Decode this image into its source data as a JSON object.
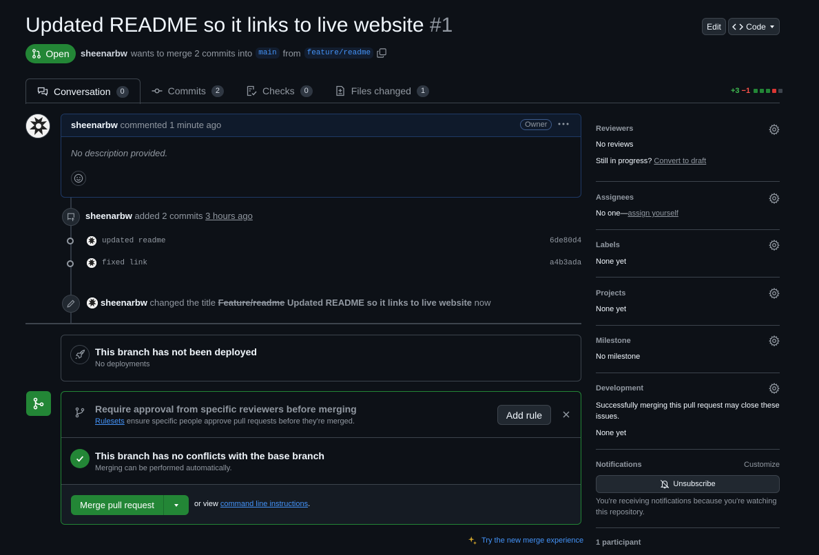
{
  "header": {
    "title": "Updated README so it links to live website",
    "number": "#1",
    "edit_label": "Edit",
    "code_label": "Code"
  },
  "status": {
    "state": "Open",
    "author": "sheenarbw",
    "merge_text": "wants to merge 2 commits into",
    "base_branch": "main",
    "from_text": "from",
    "head_branch": "feature/readme"
  },
  "tabs": [
    {
      "label": "Conversation",
      "count": "0"
    },
    {
      "label": "Commits",
      "count": "2"
    },
    {
      "label": "Checks",
      "count": "0"
    },
    {
      "label": "Files changed",
      "count": "1"
    }
  ],
  "diffstat": {
    "additions": "+3",
    "deletions": "−1",
    "colors": [
      "#238636",
      "#238636",
      "#238636",
      "#da3633",
      "#3d444d"
    ]
  },
  "comment": {
    "author": "sheenarbw",
    "action": "commented 1 minute ago",
    "role": "Owner",
    "body": "No description provided."
  },
  "timeline": {
    "commits_event": {
      "author": "sheenarbw",
      "text": "added 2 commits",
      "time": "3 hours ago"
    },
    "commits": [
      {
        "message": "updated readme",
        "sha": "6de80d4"
      },
      {
        "message": "fixed link",
        "sha": "a4b3ada"
      }
    ],
    "rename_event": {
      "author": "sheenarbw",
      "text": "changed the title",
      "old_title": "Feature/readme",
      "new_title": "Updated README so it links to live website",
      "time": "now"
    }
  },
  "deploy": {
    "title": "This branch has not been deployed",
    "subtitle": "No deployments"
  },
  "merge": {
    "ruleset_title": "Require approval from specific reviewers before merging",
    "ruleset_link": "Rulesets",
    "ruleset_text": "ensure specific people approve pull requests before they're merged.",
    "add_rule": "Add rule",
    "conflict_title": "This branch has no conflicts with the base branch",
    "conflict_text": "Merging can be performed automatically.",
    "merge_button": "Merge pull request",
    "or_view": "or view",
    "cli_link": "command line instructions",
    "period": ".",
    "try_new": "Try the new merge experience"
  },
  "sidebar": {
    "reviewers": {
      "title": "Reviewers",
      "value": "No reviews",
      "draft_prefix": "Still in progress?",
      "draft_link": "Convert to draft"
    },
    "assignees": {
      "title": "Assignees",
      "prefix": "No one—",
      "link": "assign yourself"
    },
    "labels": {
      "title": "Labels",
      "value": "None yet"
    },
    "projects": {
      "title": "Projects",
      "value": "None yet"
    },
    "milestone": {
      "title": "Milestone",
      "value": "No milestone"
    },
    "development": {
      "title": "Development",
      "text": "Successfully merging this pull request may close these issues.",
      "value": "None yet"
    },
    "notifications": {
      "title": "Notifications",
      "customize": "Customize",
      "unsubscribe": "Unsubscribe",
      "reason": "You're receiving notifications because you're watching this repository."
    },
    "participants": {
      "title": "1 participant"
    }
  }
}
